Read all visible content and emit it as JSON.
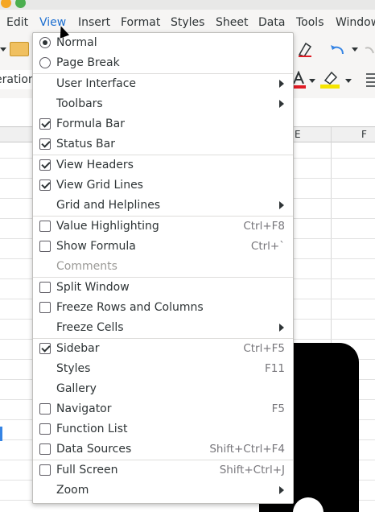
{
  "menubar": {
    "items": [
      "Edit",
      "View",
      "Insert",
      "Format",
      "Styles",
      "Sheet",
      "Data",
      "Tools",
      "Window"
    ]
  },
  "namebox_text": "eration",
  "columns": [
    "E",
    "F"
  ],
  "view_menu": {
    "items": [
      {
        "label": "Normal",
        "control": "radio",
        "checked": true
      },
      {
        "label": "Page Break",
        "control": "radio",
        "checked": false
      },
      {
        "label": "User Interface",
        "submenu": true
      },
      {
        "label": "Toolbars",
        "submenu": true
      },
      {
        "label": "Formula Bar",
        "control": "checkbox",
        "checked": true
      },
      {
        "label": "Status Bar",
        "control": "checkbox",
        "checked": true
      },
      {
        "label": "View Headers",
        "control": "checkbox",
        "checked": true
      },
      {
        "label": "View Grid Lines",
        "control": "checkbox",
        "checked": true
      },
      {
        "label": "Grid and Helplines",
        "submenu": true
      },
      {
        "label": "Value Highlighting",
        "control": "checkbox",
        "checked": false,
        "shortcut": "Ctrl+F8"
      },
      {
        "label": "Show Formula",
        "control": "checkbox",
        "checked": false,
        "shortcut": "Ctrl+`"
      },
      {
        "label": "Comments",
        "disabled": true
      },
      {
        "label": "Split Window",
        "control": "checkbox",
        "checked": false
      },
      {
        "label": "Freeze Rows and Columns",
        "control": "checkbox",
        "checked": false
      },
      {
        "label": "Freeze Cells",
        "submenu": true
      },
      {
        "label": "Sidebar",
        "control": "checkbox",
        "checked": true,
        "shortcut": "Ctrl+F5"
      },
      {
        "label": "Styles",
        "shortcut": "F11"
      },
      {
        "label": "Gallery"
      },
      {
        "label": "Navigator",
        "control": "checkbox",
        "checked": false,
        "shortcut": "F5"
      },
      {
        "label": "Function List",
        "control": "checkbox",
        "checked": false
      },
      {
        "label": "Data Sources",
        "control": "checkbox",
        "checked": false,
        "shortcut": "Shift+Ctrl+F4"
      },
      {
        "label": "Full Screen",
        "control": "checkbox",
        "checked": false,
        "shortcut": "Shift+Ctrl+J"
      },
      {
        "label": "Zoom",
        "submenu": true
      }
    ]
  },
  "icons": {
    "folder": "folder-icon",
    "undo": "undo-icon",
    "clear-format": "clear-format-icon",
    "font-color": "font-color-icon",
    "highlight": "highlight-icon",
    "align": "align-icon"
  },
  "colors": {
    "accent": "#3584e4",
    "highlight_yellow": "#f5e400",
    "font_red": "#e01b24"
  }
}
